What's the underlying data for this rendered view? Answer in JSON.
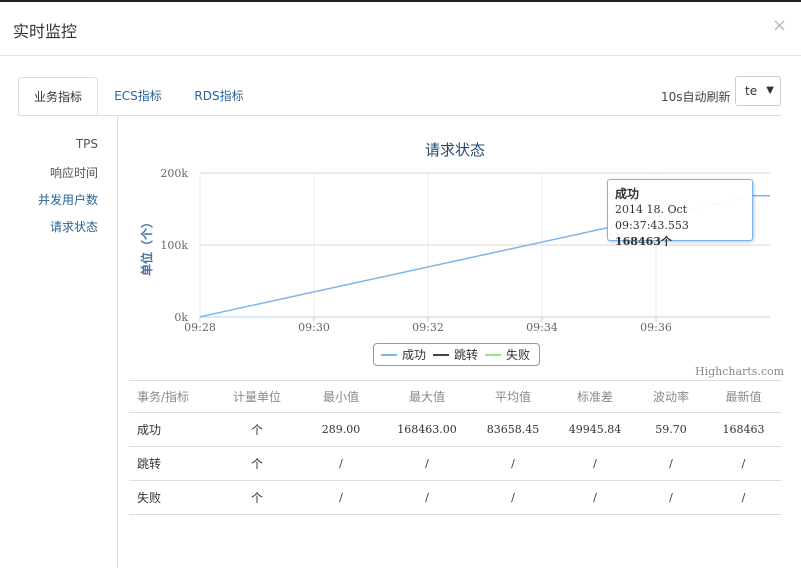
{
  "modal": {
    "title": "实时监控",
    "close_label": "×"
  },
  "tabs": [
    {
      "label": "业务指标",
      "active": true
    },
    {
      "label": "ECS指标",
      "active": false
    },
    {
      "label": "RDS指标",
      "active": false
    }
  ],
  "refresh": {
    "label": "10s自动刷新",
    "selected": "te",
    "caret": "▼"
  },
  "side_nav": [
    {
      "label": "TPS",
      "active": false
    },
    {
      "label": "响应时间",
      "active": false
    },
    {
      "label": "并发用户数",
      "active": false
    },
    {
      "label": "请求状态",
      "active": true
    }
  ],
  "chart_data": {
    "type": "line",
    "title": "请求状态",
    "ylabel": "单位（个）",
    "xlabel": "",
    "x_ticks": [
      "09:28",
      "09:30",
      "09:32",
      "09:34",
      "09:36"
    ],
    "y_ticks": [
      "0k",
      "100k",
      "200k"
    ],
    "xlim": [
      "09:28:00",
      "09:38:00"
    ],
    "ylim": [
      0,
      200000
    ],
    "grid": true,
    "series": [
      {
        "name": "成功",
        "color": "#7cb5ec",
        "points": [
          [
            "09:28:00",
            289
          ],
          [
            "09:37:43",
            168463
          ],
          [
            "09:38:00",
            168463
          ]
        ]
      },
      {
        "name": "跳转",
        "color": "#434348",
        "points": []
      },
      {
        "name": "失败",
        "color": "#90ed7d",
        "points": []
      }
    ],
    "tooltip": {
      "series": "成功",
      "time": "2014 18. Oct 09:37:43.553",
      "value": "168463个"
    },
    "legend_position": "bottom-center",
    "credits": "Highcharts.com"
  },
  "table": {
    "headers": [
      "事务/指标",
      "计量单位",
      "最小值",
      "最大值",
      "平均值",
      "标准差",
      "波动率",
      "最新值"
    ],
    "rows": [
      [
        "成功",
        "个",
        "289.00",
        "168463.00",
        "83658.45",
        "49945.84",
        "59.70",
        "168463"
      ],
      [
        "跳转",
        "个",
        "/",
        "/",
        "/",
        "/",
        "/",
        "/"
      ],
      [
        "失败",
        "个",
        "/",
        "/",
        "/",
        "/",
        "/",
        "/"
      ]
    ]
  }
}
